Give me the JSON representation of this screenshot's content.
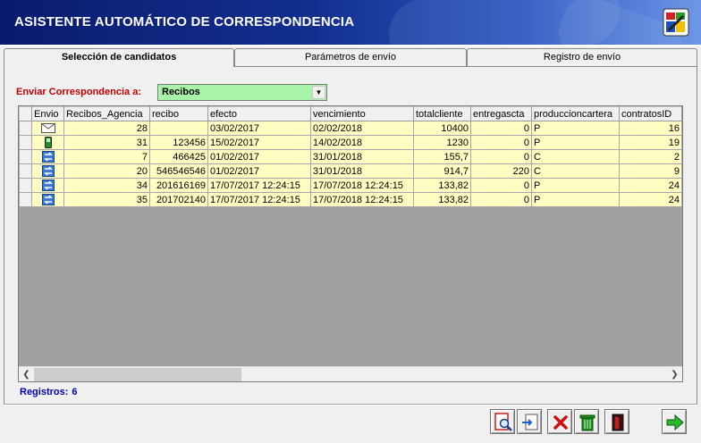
{
  "header": {
    "title": "ASISTENTE AUTOMÁTICO DE CORRESPONDENCIA",
    "logo_icon": "app-logo-icon"
  },
  "tabs": [
    {
      "label": "Selección de candidatos",
      "active": true
    },
    {
      "label": "Parámetros de envío",
      "active": false
    },
    {
      "label": "Registro de envío",
      "active": false
    }
  ],
  "filter": {
    "label": "Enviar Correspondencia a:",
    "selected": "Recibos",
    "background": "#a9f3a9"
  },
  "grid": {
    "columns": [
      "Envio",
      "Recibos_Agencia",
      "recibo",
      "efecto",
      "vencimiento",
      "totalcliente",
      "entregascta",
      "produccioncartera",
      "contratosID"
    ],
    "rows": [
      {
        "envio_icon": "envelope-icon",
        "Recibos_Agencia": "28",
        "recibo": "",
        "efecto": "03/02/2017",
        "vencimiento": "02/02/2018",
        "totalcliente": "10400",
        "entregascta": "0",
        "produccioncartera": "P",
        "contratosID": "16"
      },
      {
        "envio_icon": "phone-icon",
        "Recibos_Agencia": "31",
        "recibo": "123456",
        "efecto": "15/02/2017",
        "vencimiento": "14/02/2018",
        "totalcliente": "1230",
        "entregascta": "0",
        "produccioncartera": "P",
        "contratosID": "19"
      },
      {
        "envio_icon": "transfer-icon",
        "Recibos_Agencia": "7",
        "recibo": "466425",
        "efecto": "01/02/2017",
        "vencimiento": "31/01/2018",
        "totalcliente": "155,7",
        "entregascta": "0",
        "produccioncartera": "C",
        "contratosID": "2"
      },
      {
        "envio_icon": "transfer-icon",
        "Recibos_Agencia": "20",
        "recibo": "546546546",
        "efecto": "01/02/2017",
        "vencimiento": "31/01/2018",
        "totalcliente": "914,7",
        "entregascta": "220",
        "produccioncartera": "C",
        "contratosID": "9"
      },
      {
        "envio_icon": "transfer-icon",
        "Recibos_Agencia": "34",
        "recibo": "201616169",
        "efecto": "17/07/2017 12:24:15",
        "vencimiento": "17/07/2018 12:24:15",
        "totalcliente": "133,82",
        "entregascta": "0",
        "produccioncartera": "P",
        "contratosID": "24"
      },
      {
        "envio_icon": "transfer-icon",
        "Recibos_Agencia": "35",
        "recibo": "201702140",
        "efecto": "17/07/2017 12:24:15",
        "vencimiento": "17/07/2018 12:24:15",
        "totalcliente": "133,82",
        "entregascta": "0",
        "produccioncartera": "P",
        "contratosID": "24"
      }
    ]
  },
  "status": {
    "label": "Registros:",
    "count": "6"
  },
  "toolbar": {
    "buttons": [
      {
        "name": "preview-button",
        "icon": "print-preview-icon"
      },
      {
        "name": "export-button",
        "icon": "export-icon"
      },
      {
        "name": "cancel-button",
        "icon": "red-x-icon"
      },
      {
        "name": "delete-button",
        "icon": "trash-icon"
      },
      {
        "name": "exit-button",
        "icon": "door-exit-icon"
      },
      {
        "name": "next-button",
        "icon": "green-arrow-right-icon"
      }
    ]
  },
  "colors": {
    "header_dark": "#0a1a6e",
    "row_bg": "#ffffc4",
    "grid_empty": "#a0a0a0",
    "label_red": "#c00000",
    "label_blue": "#0000b0"
  }
}
